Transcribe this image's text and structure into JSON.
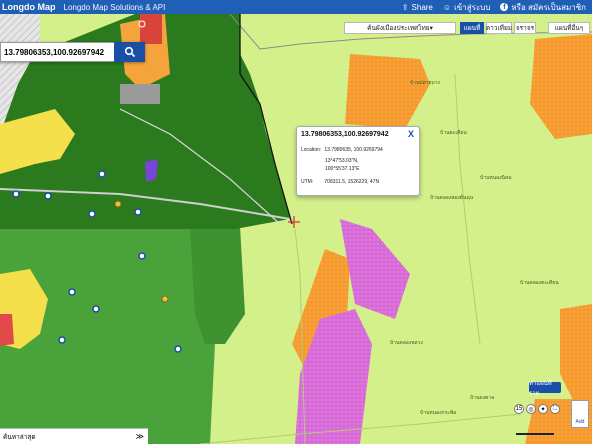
{
  "app": {
    "logo": "Longdo Map",
    "subtitle": "Longdo Map Solutions & API",
    "share": "Share",
    "login": "เข้าสู่ระบบ",
    "signup": "หรือ สมัครเป็นสมาชิก"
  },
  "search": {
    "value": "13.79806353,100.92697942"
  },
  "map_tabs": {
    "layer_select": "ค้นผังเมืองประเทศไทย",
    "tab_map": "แผนที่",
    "tab_theme": "ดาวเทียม",
    "tab_traffic": "จราจร",
    "more": "แผนที่อื่นๆ"
  },
  "popup": {
    "title": "13.79806353,100.92697942",
    "close": "X",
    "location_label": "Location:",
    "location_value": "13.7980635, 100.9269794",
    "dms_lat": "13°47'53.03\"N,",
    "dms_lon": "100°55'37.13\"E",
    "utm_label": "UTM:",
    "utm_value": "708311.5, 1526229, 47N"
  },
  "controls": {
    "layer_button": "ทำแผนที่ราย",
    "add_button": "Add"
  },
  "footer": {
    "label": "ค้นหาล่าสุด",
    "chevron": "≫"
  },
  "colors": {
    "topbar": "#1f5fb6",
    "zone_light_green": "#d4f08a",
    "zone_dark_green": "#2b7a1e",
    "zone_mid_green": "#4aa23a",
    "zone_orange": "#f79a2e",
    "zone_magenta": "#d86ad8",
    "zone_yellow": "#f4e04a"
  },
  "place_labels": [
    "บ้านปลายบาง",
    "บ้านตะเคียน",
    "บ้านหนองนิคม",
    "บ้านคลองสองต้นนุ่น",
    "บ้านคลองหลวง",
    "บ้านดงตาล",
    "บ้านคลองตะเคียน",
    "บ้านหนองกระพ้อ"
  ]
}
